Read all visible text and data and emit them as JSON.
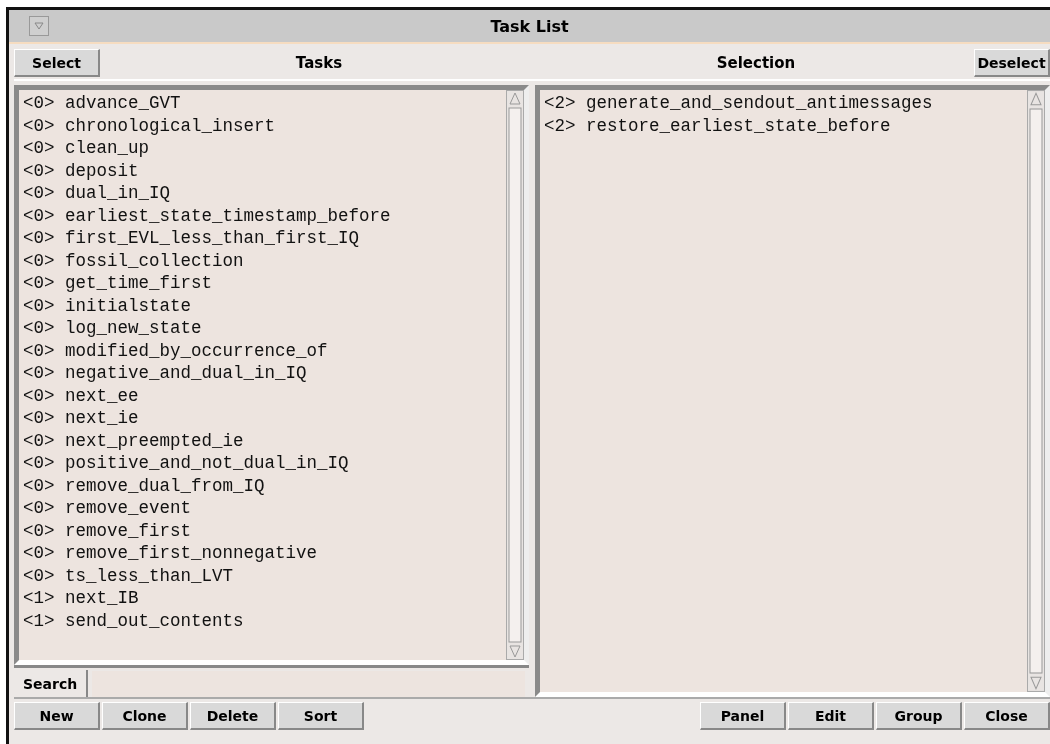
{
  "window": {
    "title": "Task List"
  },
  "tasks_panel": {
    "button": "Select",
    "heading": "Tasks",
    "items": [
      "<0> advance_GVT",
      "<0> chronological_insert",
      "<0> clean_up",
      "<0> deposit",
      "<0> dual_in_IQ",
      "<0> earliest_state_timestamp_before",
      "<0> first_EVL_less_than_first_IQ",
      "<0> fossil_collection",
      "<0> get_time_first",
      "<0> initialstate",
      "<0> log_new_state",
      "<0> modified_by_occurrence_of",
      "<0> negative_and_dual_in_IQ",
      "<0> next_ee",
      "<0> next_ie",
      "<0> next_preempted_ie",
      "<0> positive_and_not_dual_in_IQ",
      "<0> remove_dual_from_IQ",
      "<0> remove_event",
      "<0> remove_first",
      "<0> remove_first_nonnegative",
      "<0> ts_less_than_LVT",
      "<1> next_IB",
      "<1> send_out_contents"
    ]
  },
  "selection_panel": {
    "button": "Deselect",
    "heading": "Selection",
    "items": [
      "<2> generate_and_sendout_antimessages",
      "<2> restore_earliest_state_before"
    ]
  },
  "search": {
    "label": "Search"
  },
  "left_buttons": [
    "New",
    "Clone",
    "Delete",
    "Sort"
  ],
  "right_buttons": [
    "Panel",
    "Edit",
    "Group",
    "Close"
  ]
}
